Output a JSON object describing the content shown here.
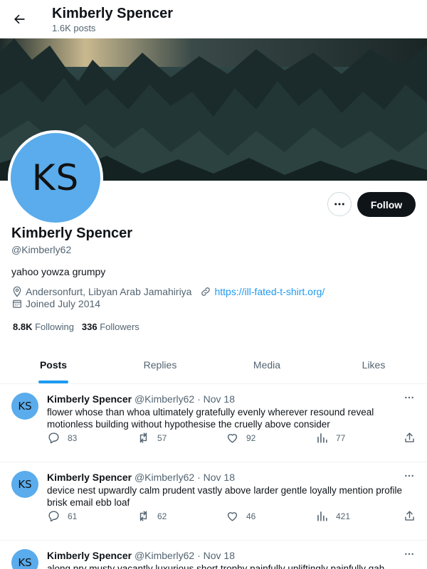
{
  "header": {
    "title": "Kimberly Spencer",
    "subtitle": "1.6K posts"
  },
  "profile": {
    "initials": "KS",
    "name": "Kimberly Spencer",
    "handle": "@Kimberly62",
    "bio": "yahoo yowza grumpy",
    "location": "Andersonfurt, Libyan Arab Jamahiriya",
    "website": "https://ill-fated-t-shirt.org/",
    "joined": "Joined July 2014",
    "following_count": "8.8K",
    "following_label": "Following",
    "followers_count": "336",
    "followers_label": "Followers",
    "follow_label": "Follow",
    "avatar_color": "#5aacec"
  },
  "tabs": [
    {
      "label": "Posts",
      "active": true
    },
    {
      "label": "Replies",
      "active": false
    },
    {
      "label": "Media",
      "active": false
    },
    {
      "label": "Likes",
      "active": false
    }
  ],
  "posts": [
    {
      "name": "Kimberly Spencer",
      "handle": "@Kimberly62",
      "date": "· Nov 18",
      "text": "flower whose than whoa ultimately gratefully evenly wherever resound reveal motionless building without hypothesise the cruelly above consider",
      "replies": "83",
      "reposts": "57",
      "likes": "92",
      "views": "77"
    },
    {
      "name": "Kimberly Spencer",
      "handle": "@Kimberly62",
      "date": "· Nov 18",
      "text": "device nest upwardly calm prudent vastly above larder gentle loyally mention profile brisk email ebb loaf",
      "replies": "61",
      "reposts": "62",
      "likes": "46",
      "views": "421"
    },
    {
      "name": "Kimberly Spencer",
      "handle": "@Kimberly62",
      "date": "· Nov 18",
      "text": "along pry musty vacantly luxurious short trophy painfully upliftingly painfully gah",
      "replies": "",
      "reposts": "",
      "likes": "",
      "views": ""
    }
  ],
  "colors": {
    "accent": "#1d9bf0",
    "follow_button": "#0f1419",
    "secondary_text": "#536471"
  }
}
